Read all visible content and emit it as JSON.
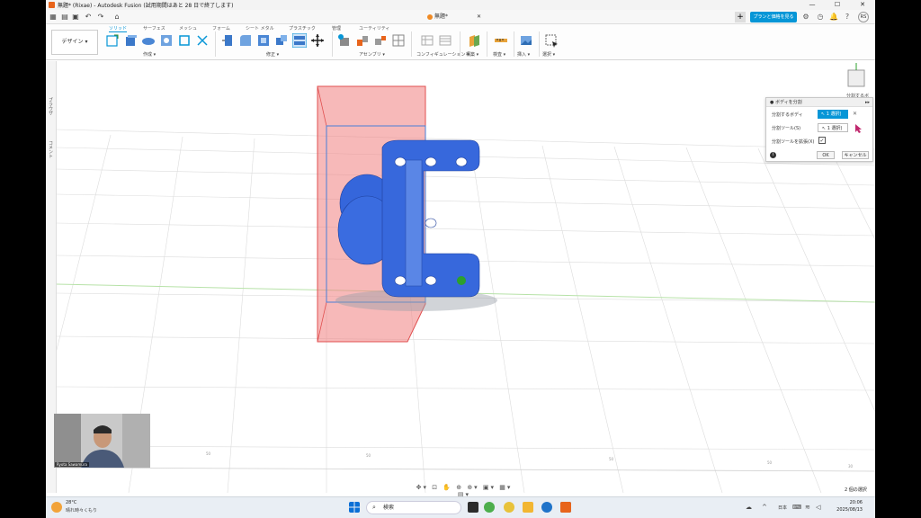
{
  "titlebar": {
    "title": "無題* (Rixae) - Autodesk Fusion (試用期間はあと 28 日で終了します)",
    "minimize": "—",
    "maximize": "☐",
    "close": "✕"
  },
  "appbar": {
    "doc_tab": "無題*",
    "upgrade_label": "プランと価格を見る",
    "avatar": "RS"
  },
  "ribbon": {
    "workspace": "デザイン ▾",
    "tabs": [
      "ソリッド",
      "サーフェス",
      "メッシュ",
      "フォーム",
      "シート メタル",
      "プラスチック",
      "管理",
      "ユーティリティ"
    ],
    "groups": [
      "作成 ▾",
      "修正 ▾",
      "アセンブリ ▾",
      "コンフィギュレーション ▾",
      "構築 ▾",
      "検査 ▾",
      "挿入 ▾",
      "選択 ▾"
    ]
  },
  "left_strip": {
    "label_1": "ブラウザ",
    "label_2": "コメント"
  },
  "viewcube": {
    "label": "分割するボ"
  },
  "dialog": {
    "title": "ボディを分割",
    "row1_label": "分割するボディ",
    "row1_value": "1 選択(",
    "row2_label": "分割ツール(S)",
    "row2_value": "1 選択(",
    "row3_label": "分割ツールを拡張(X)",
    "ok": "OK",
    "cancel": "キャンセル",
    "info": "i"
  },
  "webcam": {
    "name": "Ryota Sawamura"
  },
  "status": {
    "selection_count": "2 個の選択"
  },
  "navbar": {
    "icons": "✥▾ ⊡ ✋ ⊕ ⊕▾ ▣▾ ▦▾ ▤▾"
  },
  "taskbar": {
    "weather_temp": "28°C",
    "weather_desc": "晴れ時々くもり",
    "search_placeholder": "検索",
    "lang": "日本",
    "time": "20:06",
    "date": "2025/08/13"
  },
  "colors": {
    "accent": "#0696d7",
    "body_blue": "#2f5fd6",
    "split_tool": "#f08080"
  }
}
